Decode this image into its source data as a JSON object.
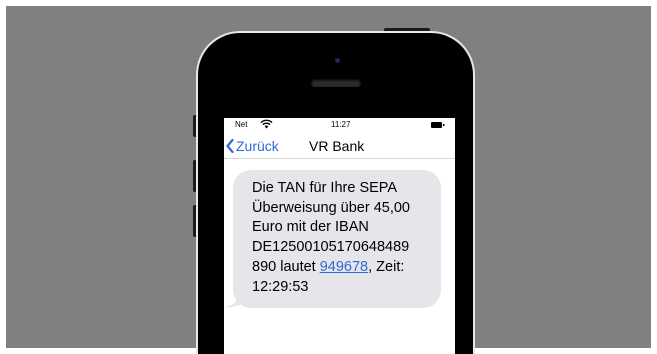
{
  "status_bar": {
    "carrier": "Net",
    "time": "11:27",
    "wifi_icon": "wifi-icon",
    "battery_icon": "battery-icon"
  },
  "nav": {
    "back_label": "Zurück",
    "back_icon": "chevron-left-icon",
    "contact_name": "VR Bank"
  },
  "message": {
    "line1": "Die TAN für Ihre SEPA",
    "line2": "Überweisung über 45,00",
    "line3": "Euro mit der IBAN",
    "line4": "DE12500105170648489",
    "line5_prefix": "890 lautet ",
    "tan": "949678",
    "line5_suffix": ", Zeit:",
    "line6": "12:29:53"
  },
  "colors": {
    "background": "#808080",
    "link_blue": "#2d6bd9",
    "bubble_gray": "#e5e5ea"
  }
}
